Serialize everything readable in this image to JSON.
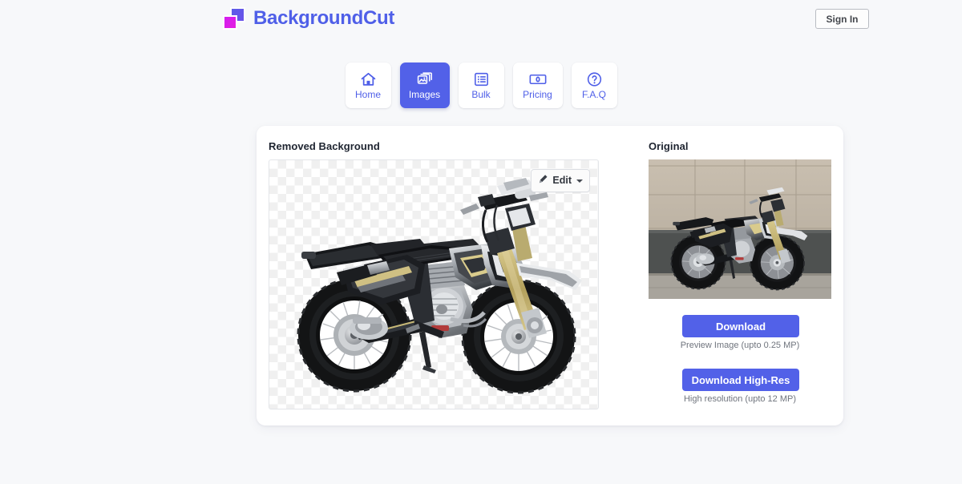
{
  "header": {
    "brand_name": "BackgroundCut",
    "logo_icon": "two-squares-logo",
    "signin_label": "Sign In",
    "brand_color": "#4f5fe8",
    "logo_blue": "#5b5be8",
    "logo_pink": "#d21ef0"
  },
  "nav": {
    "active_index": 1,
    "active_color": "#5261e8",
    "items": [
      {
        "label": "Home",
        "icon": "home-icon",
        "active": false
      },
      {
        "label": "Images",
        "icon": "images-icon",
        "active": true
      },
      {
        "label": "Bulk",
        "icon": "list-icon",
        "active": false
      },
      {
        "label": "Pricing",
        "icon": "banknote-icon",
        "active": false
      },
      {
        "label": "F.A.Q",
        "icon": "question-circle-icon",
        "active": false
      }
    ]
  },
  "main": {
    "removed_panel": {
      "title": "Removed Background",
      "edit_label": "Edit",
      "edit_icon": "brush-icon",
      "caret_icon": "caret-down-icon",
      "image_alt": "dirt-bike-cutout-transparent"
    },
    "original_panel": {
      "title": "Original",
      "image_alt": "dirt-bike-original-photo",
      "download": {
        "label": "Download",
        "caption": "Preview Image (upto 0.25 MP)"
      },
      "download_highres": {
        "label": "Download High-Res",
        "caption": "High resolution (upto 12 MP)"
      }
    }
  },
  "theme": {
    "page_background": "#f7f8fa",
    "card_background": "#ffffff",
    "accent": "#5261e8",
    "muted_text": "#6f747d"
  }
}
